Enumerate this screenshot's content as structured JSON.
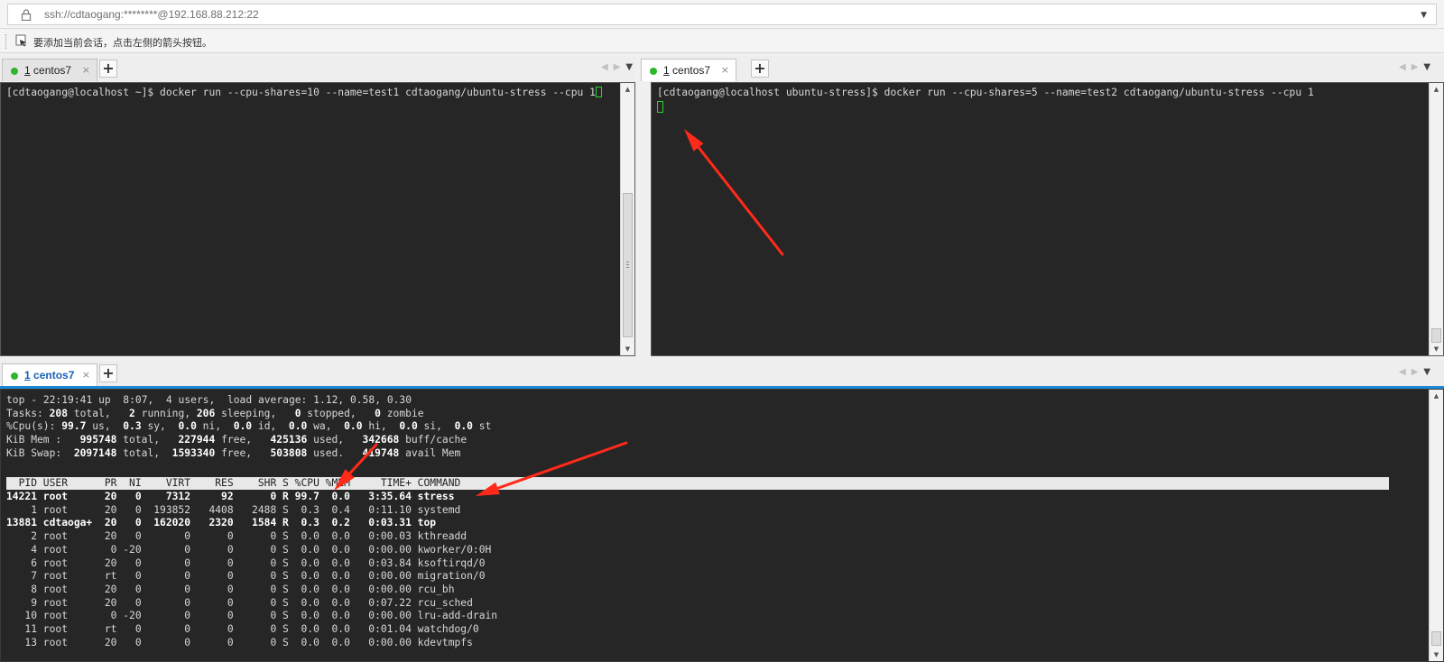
{
  "address": {
    "url": "ssh://cdtaogang:********@192.168.88.212:22"
  },
  "hint": {
    "text": "要添加当前会话，点击左侧的箭头按钮。"
  },
  "panes": {
    "top_left": {
      "tab_num": "1",
      "tab_name": "centos7",
      "command": "[cdtaogang@localhost ~]$ docker run --cpu-shares=10 --name=test1 cdtaogang/ubuntu-stress --cpu 1"
    },
    "top_right": {
      "tab_num": "1",
      "tab_name": "centos7",
      "command": "[cdtaogang@localhost ubuntu-stress]$ docker run --cpu-shares=5 --name=test2 cdtaogang/ubuntu-stress --cpu 1"
    },
    "bottom": {
      "tab_num": "1",
      "tab_name": "centos7"
    }
  },
  "top": {
    "summary": [
      "top - 22:19:41 up  8:07,  4 users,  load average: 1.12, 0.58, 0.30",
      "Tasks: 208 total,   2 running, 206 sleeping,   0 stopped,   0 zombie",
      "%Cpu(s): 99.7 us,  0.3 sy,  0.0 ni,  0.0 id,  0.0 wa,  0.0 hi,  0.0 si,  0.0 st",
      "KiB Mem :   995748 total,   227944 free,   425136 used,   342668 buff/cache",
      "KiB Swap:  2097148 total,  1593340 free,   503808 used.   419748 avail Mem"
    ],
    "header": "  PID USER      PR  NI    VIRT    RES    SHR S %CPU %MEM     TIME+ COMMAND                                                                                                                                                                    ",
    "rows": [
      {
        "text": "14221 root      20   0    7312     92      0 R 99.7  0.0   3:35.64 stress",
        "bold": true
      },
      {
        "text": "    1 root      20   0  193852   4408   2488 S  0.3  0.4   0:11.10 systemd",
        "bold": false
      },
      {
        "text": "13881 cdtaoga+  20   0  162020   2320   1584 R  0.3  0.2   0:03.31 top",
        "bold": true
      },
      {
        "text": "    2 root      20   0       0      0      0 S  0.0  0.0   0:00.03 kthreadd",
        "bold": false
      },
      {
        "text": "    4 root       0 -20       0      0      0 S  0.0  0.0   0:00.00 kworker/0:0H",
        "bold": false
      },
      {
        "text": "    6 root      20   0       0      0      0 S  0.0  0.0   0:03.84 ksoftirqd/0",
        "bold": false
      },
      {
        "text": "    7 root      rt   0       0      0      0 S  0.0  0.0   0:00.00 migration/0",
        "bold": false
      },
      {
        "text": "    8 root      20   0       0      0      0 S  0.0  0.0   0:00.00 rcu_bh",
        "bold": false
      },
      {
        "text": "    9 root      20   0       0      0      0 S  0.0  0.0   0:07.22 rcu_sched",
        "bold": false
      },
      {
        "text": "   10 root       0 -20       0      0      0 S  0.0  0.0   0:00.00 lru-add-drain",
        "bold": false
      },
      {
        "text": "   11 root      rt   0       0      0      0 S  0.0  0.0   0:01.04 watchdog/0",
        "bold": false
      },
      {
        "text": "   13 root      20   0       0      0      0 S  0.0  0.0   0:00.00 kdevtmpfs",
        "bold": false
      }
    ]
  },
  "colors": {
    "arrow": "#ff2a1a",
    "terminal_bg": "#262626",
    "tab_accent": "#1e88d8",
    "status_dot": "#2db52d"
  }
}
